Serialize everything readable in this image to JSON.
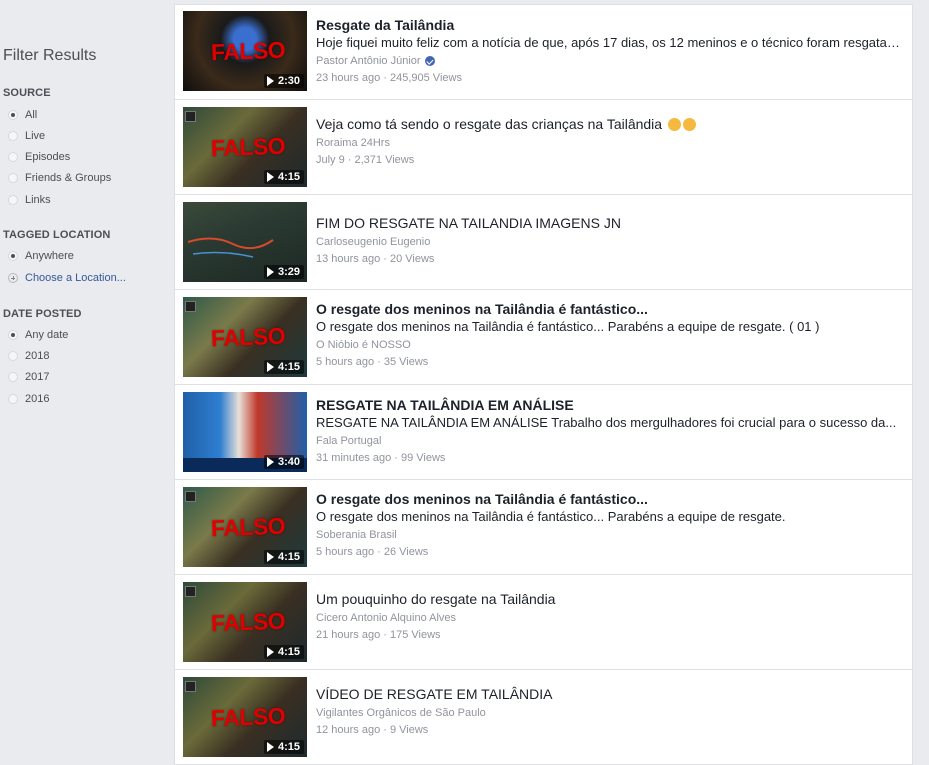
{
  "sidebar": {
    "title": "Filter Results",
    "source": {
      "heading": "SOURCE",
      "options": [
        "All",
        "Live",
        "Episodes",
        "Friends & Groups",
        "Links"
      ],
      "selected": "All"
    },
    "location": {
      "heading": "TAGGED LOCATION",
      "options": [
        "Anywhere"
      ],
      "selected": "Anywhere",
      "choose_link": "Choose a Location..."
    },
    "date": {
      "heading": "DATE POSTED",
      "options": [
        "Any date",
        "2018",
        "2017",
        "2016"
      ],
      "selected": "Any date"
    }
  },
  "results": [
    {
      "title": "Resgate da Tailândia",
      "bold": true,
      "desc": "Hoje fiquei muito feliz com a notícia de que, após 17 dias, os 12 meninos e o técnico foram resgatados...",
      "author": "Pastor Antônio Júnior",
      "verified": true,
      "meta": "23 hours ago · 245,905 Views",
      "duration": "2:30",
      "falso": "FALSO"
    },
    {
      "title": "Veja como tá sendo o resgate das crianças na Tailândia",
      "bold": false,
      "desc": "",
      "author": "Roraima 24Hrs",
      "verified": false,
      "meta": "July 9 · 2,371 Views",
      "duration": "4:15",
      "falso": "FALSO",
      "emoji": "clapping-hands"
    },
    {
      "title": "FIM DO RESGATE NA TAILANDIA IMAGENS JN",
      "bold": false,
      "desc": "",
      "author": "Carloseugenio Eugenio",
      "verified": false,
      "meta": "13 hours ago · 20 Views",
      "duration": "3:29",
      "falso": ""
    },
    {
      "title": "O resgate dos meninos na Tailândia é fantástico...",
      "bold": true,
      "desc": "O resgate dos meninos na Tailândia é fantástico... Parabéns a equipe de resgate. ( 01 )",
      "author": "O Nióbio é NOSSO",
      "verified": false,
      "meta": "5 hours ago · 35 Views",
      "duration": "4:15",
      "falso": "FALSO"
    },
    {
      "title": "RESGATE NA TAILÂNDIA EM ANÁLISE",
      "bold": true,
      "desc": "RESGATE NA TAILÂNDIA EM ANÁLISE Trabalho dos mergulhadores foi crucial para o sucesso da...",
      "author": "Fala Portugal",
      "verified": false,
      "meta": "31 minutes ago · 99 Views",
      "duration": "3:40",
      "falso": ""
    },
    {
      "title": "O resgate dos meninos na Tailândia é fantástico...",
      "bold": true,
      "desc": "O resgate dos meninos na Tailândia é fantástico... Parabéns a equipe de resgate.",
      "author": "Soberania Brasil",
      "verified": false,
      "meta": "5 hours ago · 26 Views",
      "duration": "4:15",
      "falso": "FALSO"
    },
    {
      "title": "Um pouquinho do resgate na Tailândia",
      "bold": false,
      "desc": "",
      "author": "Cicero Antonio Alquino Alves",
      "verified": false,
      "meta": "21 hours ago · 175 Views",
      "duration": "4:15",
      "falso": "FALSO"
    },
    {
      "title": "VÍDEO DE RESGATE EM TAILÂNDIA",
      "bold": false,
      "desc": "",
      "author": "Vigilantes Orgânicos de São Paulo",
      "verified": false,
      "meta": "12 hours ago · 9 Views",
      "duration": "4:15",
      "falso": "FALSO"
    }
  ],
  "colors": {
    "falso": "#e10000",
    "link": "#365899",
    "verified": "#4267b2"
  }
}
